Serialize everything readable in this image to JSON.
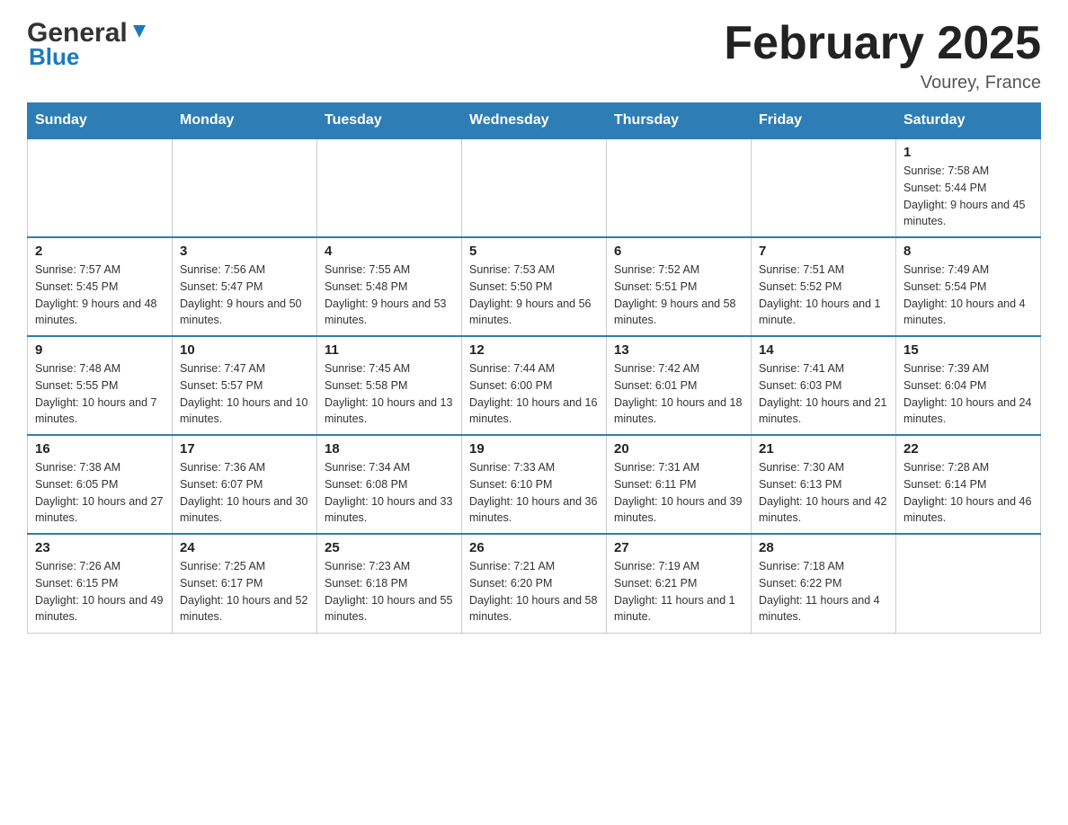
{
  "header": {
    "logo_general": "General",
    "logo_blue": "Blue",
    "month_title": "February 2025",
    "location": "Vourey, France"
  },
  "days_of_week": [
    "Sunday",
    "Monday",
    "Tuesday",
    "Wednesday",
    "Thursday",
    "Friday",
    "Saturday"
  ],
  "weeks": [
    [
      {
        "day": "",
        "info": ""
      },
      {
        "day": "",
        "info": ""
      },
      {
        "day": "",
        "info": ""
      },
      {
        "day": "",
        "info": ""
      },
      {
        "day": "",
        "info": ""
      },
      {
        "day": "",
        "info": ""
      },
      {
        "day": "1",
        "info": "Sunrise: 7:58 AM\nSunset: 5:44 PM\nDaylight: 9 hours and 45 minutes."
      }
    ],
    [
      {
        "day": "2",
        "info": "Sunrise: 7:57 AM\nSunset: 5:45 PM\nDaylight: 9 hours and 48 minutes."
      },
      {
        "day": "3",
        "info": "Sunrise: 7:56 AM\nSunset: 5:47 PM\nDaylight: 9 hours and 50 minutes."
      },
      {
        "day": "4",
        "info": "Sunrise: 7:55 AM\nSunset: 5:48 PM\nDaylight: 9 hours and 53 minutes."
      },
      {
        "day": "5",
        "info": "Sunrise: 7:53 AM\nSunset: 5:50 PM\nDaylight: 9 hours and 56 minutes."
      },
      {
        "day": "6",
        "info": "Sunrise: 7:52 AM\nSunset: 5:51 PM\nDaylight: 9 hours and 58 minutes."
      },
      {
        "day": "7",
        "info": "Sunrise: 7:51 AM\nSunset: 5:52 PM\nDaylight: 10 hours and 1 minute."
      },
      {
        "day": "8",
        "info": "Sunrise: 7:49 AM\nSunset: 5:54 PM\nDaylight: 10 hours and 4 minutes."
      }
    ],
    [
      {
        "day": "9",
        "info": "Sunrise: 7:48 AM\nSunset: 5:55 PM\nDaylight: 10 hours and 7 minutes."
      },
      {
        "day": "10",
        "info": "Sunrise: 7:47 AM\nSunset: 5:57 PM\nDaylight: 10 hours and 10 minutes."
      },
      {
        "day": "11",
        "info": "Sunrise: 7:45 AM\nSunset: 5:58 PM\nDaylight: 10 hours and 13 minutes."
      },
      {
        "day": "12",
        "info": "Sunrise: 7:44 AM\nSunset: 6:00 PM\nDaylight: 10 hours and 16 minutes."
      },
      {
        "day": "13",
        "info": "Sunrise: 7:42 AM\nSunset: 6:01 PM\nDaylight: 10 hours and 18 minutes."
      },
      {
        "day": "14",
        "info": "Sunrise: 7:41 AM\nSunset: 6:03 PM\nDaylight: 10 hours and 21 minutes."
      },
      {
        "day": "15",
        "info": "Sunrise: 7:39 AM\nSunset: 6:04 PM\nDaylight: 10 hours and 24 minutes."
      }
    ],
    [
      {
        "day": "16",
        "info": "Sunrise: 7:38 AM\nSunset: 6:05 PM\nDaylight: 10 hours and 27 minutes."
      },
      {
        "day": "17",
        "info": "Sunrise: 7:36 AM\nSunset: 6:07 PM\nDaylight: 10 hours and 30 minutes."
      },
      {
        "day": "18",
        "info": "Sunrise: 7:34 AM\nSunset: 6:08 PM\nDaylight: 10 hours and 33 minutes."
      },
      {
        "day": "19",
        "info": "Sunrise: 7:33 AM\nSunset: 6:10 PM\nDaylight: 10 hours and 36 minutes."
      },
      {
        "day": "20",
        "info": "Sunrise: 7:31 AM\nSunset: 6:11 PM\nDaylight: 10 hours and 39 minutes."
      },
      {
        "day": "21",
        "info": "Sunrise: 7:30 AM\nSunset: 6:13 PM\nDaylight: 10 hours and 42 minutes."
      },
      {
        "day": "22",
        "info": "Sunrise: 7:28 AM\nSunset: 6:14 PM\nDaylight: 10 hours and 46 minutes."
      }
    ],
    [
      {
        "day": "23",
        "info": "Sunrise: 7:26 AM\nSunset: 6:15 PM\nDaylight: 10 hours and 49 minutes."
      },
      {
        "day": "24",
        "info": "Sunrise: 7:25 AM\nSunset: 6:17 PM\nDaylight: 10 hours and 52 minutes."
      },
      {
        "day": "25",
        "info": "Sunrise: 7:23 AM\nSunset: 6:18 PM\nDaylight: 10 hours and 55 minutes."
      },
      {
        "day": "26",
        "info": "Sunrise: 7:21 AM\nSunset: 6:20 PM\nDaylight: 10 hours and 58 minutes."
      },
      {
        "day": "27",
        "info": "Sunrise: 7:19 AM\nSunset: 6:21 PM\nDaylight: 11 hours and 1 minute."
      },
      {
        "day": "28",
        "info": "Sunrise: 7:18 AM\nSunset: 6:22 PM\nDaylight: 11 hours and 4 minutes."
      },
      {
        "day": "",
        "info": ""
      }
    ]
  ]
}
